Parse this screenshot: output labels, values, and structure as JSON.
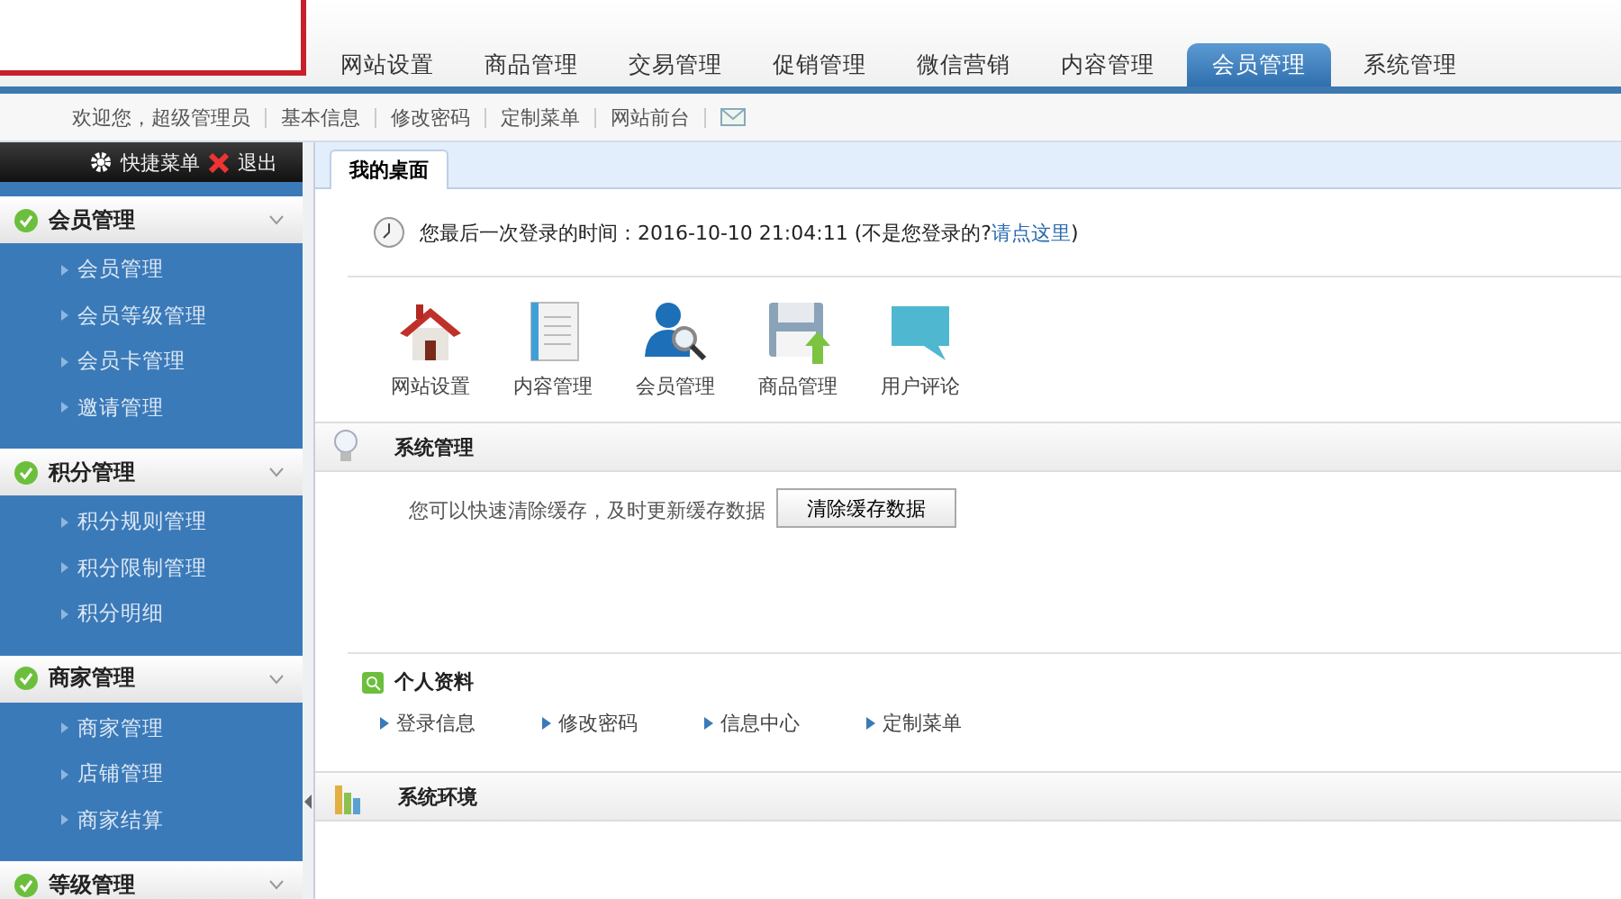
{
  "nav_tabs": [
    {
      "label": "网站设置",
      "selected": false
    },
    {
      "label": "商品管理",
      "selected": false
    },
    {
      "label": "交易管理",
      "selected": false
    },
    {
      "label": "促销管理",
      "selected": false
    },
    {
      "label": "微信营销",
      "selected": false
    },
    {
      "label": "内容管理",
      "selected": false
    },
    {
      "label": "会员管理",
      "selected": true
    },
    {
      "label": "系统管理",
      "selected": false
    }
  ],
  "sub_bar": {
    "welcome": "欢迎您，超级管理员",
    "links": [
      "基本信息",
      "修改密码",
      "定制菜单",
      "网站前台"
    ]
  },
  "sidebar": {
    "quick_menu": "快捷菜单",
    "logout": "退出",
    "groups": [
      {
        "title": "会员管理",
        "items": [
          "会员管理",
          "会员等级管理",
          "会员卡管理",
          "邀请管理"
        ]
      },
      {
        "title": "积分管理",
        "items": [
          "积分规则管理",
          "积分限制管理",
          "积分明细"
        ]
      },
      {
        "title": "商家管理",
        "items": [
          "商家管理",
          "店铺管理",
          "商家结算"
        ]
      },
      {
        "title": "等级管理"
      }
    ]
  },
  "page_tabs": [
    {
      "label": "我的桌面",
      "selected": true
    }
  ],
  "last_login": {
    "text": "您最后一次登录的时间：2016-10-10 21:04:11 (不是您登录的?",
    "link": "请点这里",
    "close": ")"
  },
  "shortcuts": [
    {
      "kind": "house",
      "label": "网站设置"
    },
    {
      "kind": "document",
      "label": "内容管理"
    },
    {
      "kind": "user",
      "label": "会员管理"
    },
    {
      "kind": "disk",
      "label": "商品管理"
    },
    {
      "kind": "comment",
      "label": "用户评论"
    }
  ],
  "system": {
    "title": "系统管理",
    "hint": "您可以快速清除缓存，及时更新缓存数据",
    "button": "清除缓存数据"
  },
  "profile": {
    "title": "个人资料",
    "links": [
      "登录信息",
      "修改密码",
      "信息中心",
      "定制菜单"
    ]
  },
  "environment": {
    "title": "系统环境"
  }
}
